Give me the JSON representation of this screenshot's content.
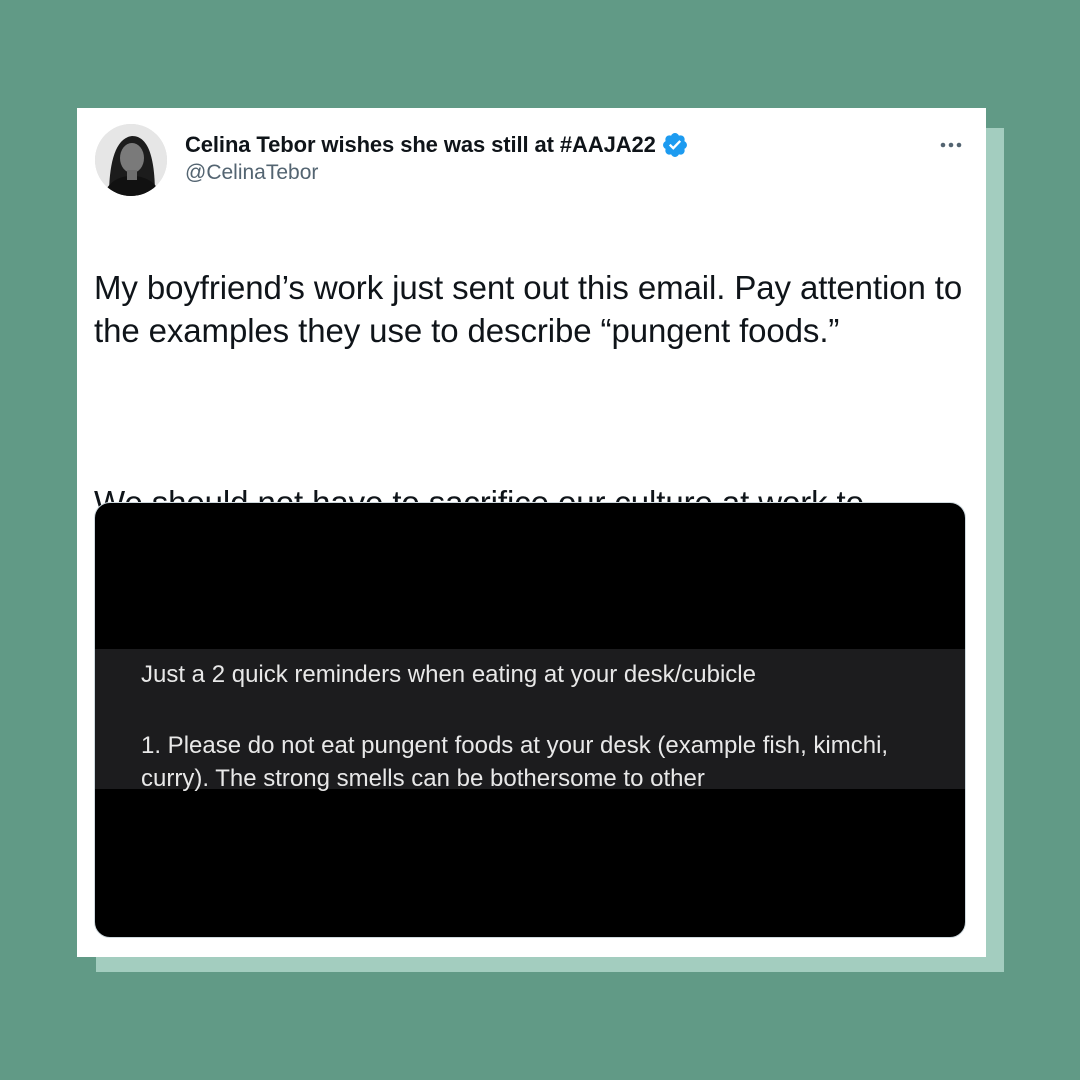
{
  "tweet": {
    "author_name": "Celina Tebor wishes she was still at #AAJA22",
    "handle": "@CelinaTebor",
    "verified": true,
    "text_paragraph_1": "My boyfriend’s work just sent out this email. Pay attention to the examples they use to describe “pungent foods.”",
    "text_paragraph_2": "We should not have to sacrifice our culture at work to appease white people’s palates.",
    "more_icon": "more-horizontal-icon"
  },
  "media": {
    "email_subject": "Just a 2 quick reminders when eating at your desk/cubicle",
    "email_body": "1. Please do not eat pungent foods at your desk (example fish, kimchi, curry). The strong smells can be bothersome to other"
  },
  "colors": {
    "background": "#619a86",
    "shadow_card": "#a3cdbf",
    "verified_blue": "#1d9bf0",
    "text_primary": "#0f1419",
    "text_secondary": "#536471"
  }
}
